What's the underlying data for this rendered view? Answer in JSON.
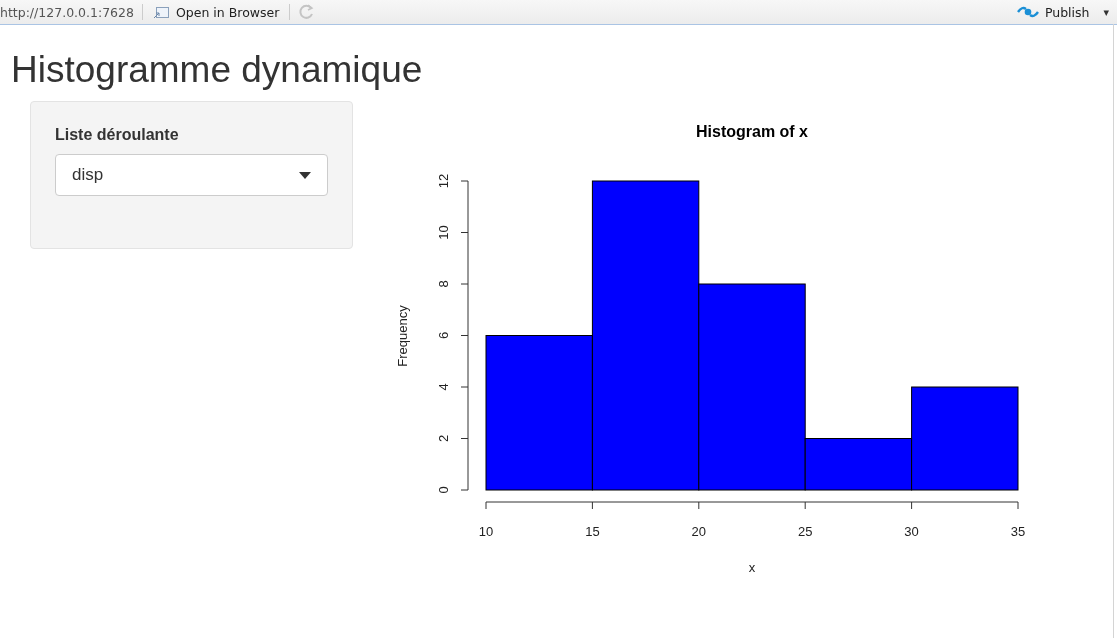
{
  "toolbar": {
    "url": "http://127.0.0.1:7628",
    "open_button": "Open in Browser",
    "publish_button": "Publish",
    "publish_caret": "▾"
  },
  "title": "Histogramme dynamique",
  "sidebar": {
    "label": "Liste déroulante",
    "select": {
      "value": "disp"
    }
  },
  "plot": {
    "chart_data": {
      "type": "bar",
      "title": "Histogram of x",
      "xlabel": "x",
      "ylabel": "Frequency",
      "x": [
        12.5,
        17.5,
        22.5,
        27.5,
        32.5
      ],
      "series": [
        {
          "color": "#0000ff",
          "values": [
            6,
            12,
            8,
            2,
            4
          ]
        }
      ],
      "xlim": [
        10,
        35
      ],
      "ylim": [
        0,
        12
      ],
      "xticks": [
        10,
        15,
        20,
        25,
        30,
        35
      ],
      "yticks": [
        0,
        2,
        4,
        6,
        8,
        10,
        12
      ]
    }
  }
}
